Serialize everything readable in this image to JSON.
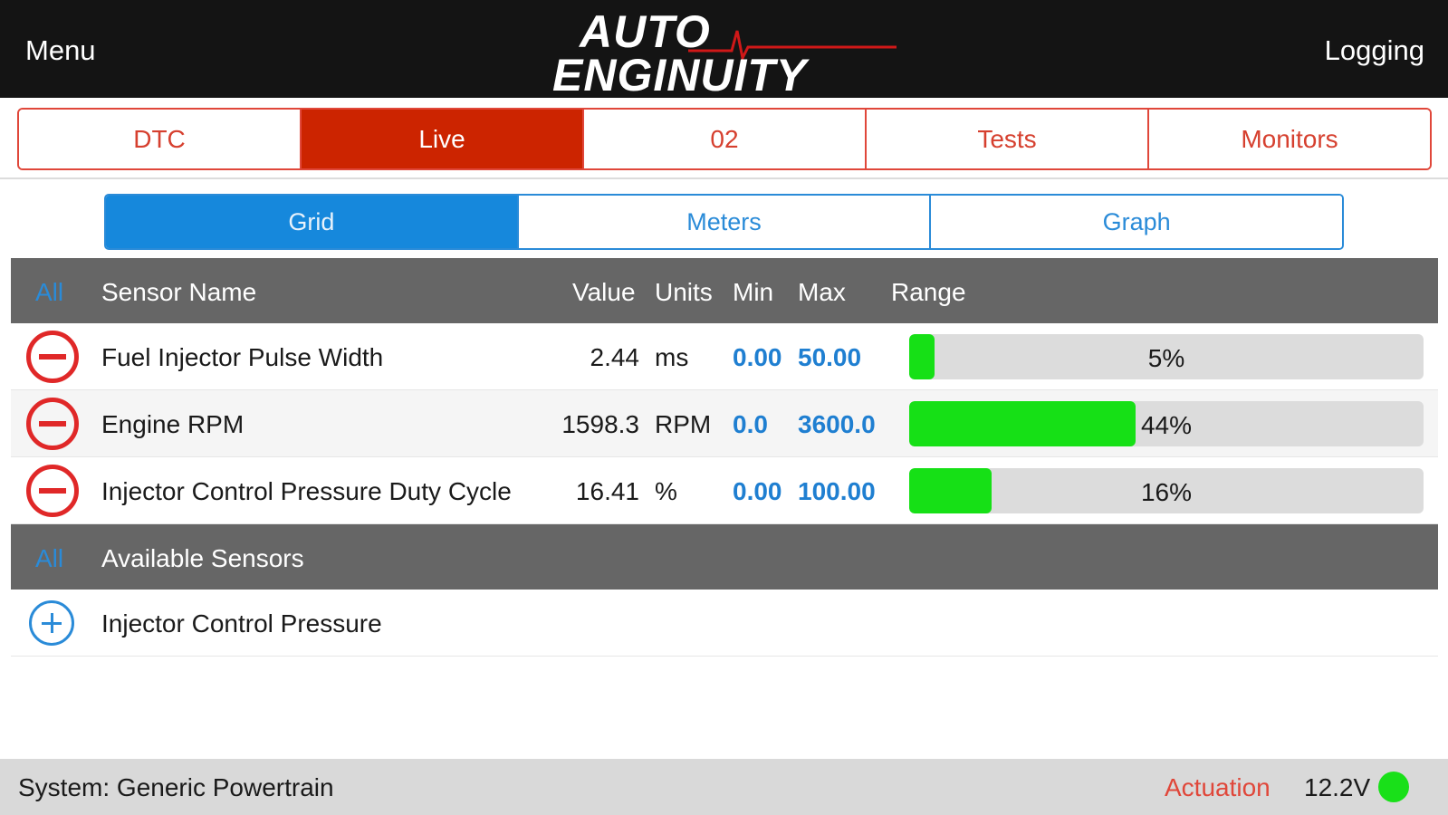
{
  "header": {
    "menu_label": "Menu",
    "logging_label": "Logging",
    "logo_line1": "AUTO",
    "logo_line2": "ENGINUITY"
  },
  "main_tabs": [
    {
      "label": "DTC",
      "active": false
    },
    {
      "label": "Live",
      "active": true
    },
    {
      "label": "02",
      "active": false
    },
    {
      "label": "Tests",
      "active": false
    },
    {
      "label": "Monitors",
      "active": false
    }
  ],
  "sub_tabs": [
    {
      "label": "Grid",
      "active": true
    },
    {
      "label": "Meters",
      "active": false
    },
    {
      "label": "Graph",
      "active": false
    }
  ],
  "table": {
    "headers": {
      "all": "All",
      "sensor_name": "Sensor Name",
      "value": "Value",
      "units": "Units",
      "min": "Min",
      "max": "Max",
      "range": "Range"
    },
    "rows": [
      {
        "name": "Fuel Injector Pulse Width",
        "value": "2.44",
        "units": "ms",
        "min": "0.00",
        "max": "50.00",
        "range_label": "5%",
        "range_fraction": 0.05
      },
      {
        "name": "Engine RPM",
        "value": "1598.3",
        "units": "RPM",
        "min": "0.0",
        "max": "3600.0",
        "range_label": "44%",
        "range_fraction": 0.44
      },
      {
        "name": "Injector Control Pressure Duty Cycle",
        "value": "16.41",
        "units": "%",
        "min": "0.00",
        "max": "100.00",
        "range_label": "16%",
        "range_fraction": 0.16
      }
    ]
  },
  "available": {
    "all": "All",
    "title": "Available Sensors",
    "items": [
      {
        "name": "Injector Control Pressure"
      }
    ]
  },
  "status": {
    "system": "System: Generic Powertrain",
    "actuation": "Actuation",
    "voltage": "12.2V"
  },
  "colors": {
    "accent_red": "#cc2400",
    "accent_blue": "#1688dc",
    "bar_green": "#16e016"
  }
}
